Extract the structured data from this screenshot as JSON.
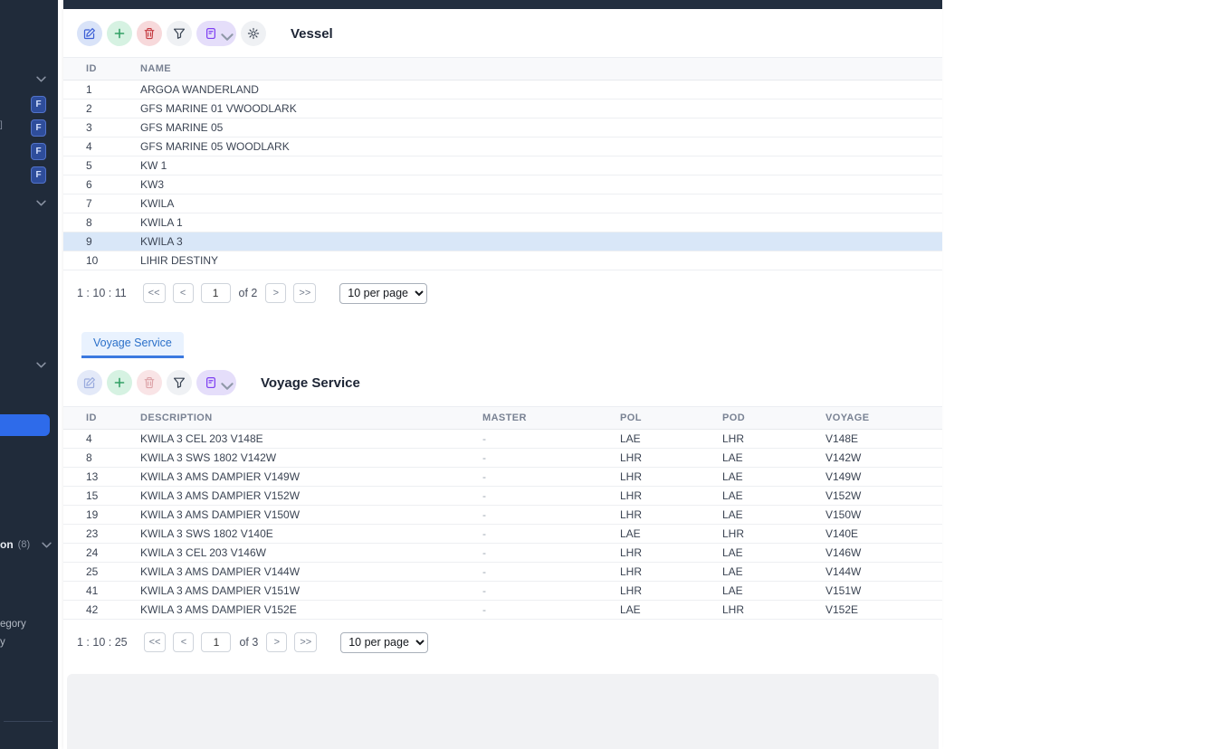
{
  "colors": {
    "sidebar_bg": "#202b3a",
    "accent_blue": "#2e6bea",
    "edit_blue": "#3c5fd6",
    "add_green": "#32a065",
    "delete_red": "#c4393f",
    "doc_purple": "#7e3ff2",
    "selected_row": "#d9e7f8",
    "tab_blue": "#2b70c9"
  },
  "sidebar": {
    "badges": [
      "F",
      "F",
      "F",
      "F"
    ],
    "truncated": {
      "bracket": "]",
      "item_label": "on",
      "item_count": "(8)",
      "text1": "egory",
      "text2": "y"
    }
  },
  "vessel_panel": {
    "title": "Vessel",
    "columns": [
      "ID",
      "NAME"
    ],
    "rows": [
      [
        "1",
        "ARGOA WANDERLAND"
      ],
      [
        "2",
        "GFS MARINE 01 VWOODLARK"
      ],
      [
        "3",
        "GFS MARINE 05"
      ],
      [
        "4",
        "GFS MARINE 05 WOODLARK"
      ],
      [
        "5",
        "KW 1"
      ],
      [
        "6",
        "KW3"
      ],
      [
        "7",
        "KWILA"
      ],
      [
        "8",
        "KWILA 1"
      ],
      [
        "9",
        "KWILA 3"
      ],
      [
        "10",
        "LIHIR DESTINY"
      ]
    ],
    "selected_index": 8,
    "pagination": {
      "range": "1 : 10 : 11",
      "first": "<<",
      "prev": "<",
      "page": "1",
      "of": "of 2",
      "next": ">",
      "last": ">>",
      "per_page": "10 per page"
    }
  },
  "tabs": {
    "voyage_service": "Voyage Service"
  },
  "voyage_panel": {
    "title": "Voyage Service",
    "columns": [
      "ID",
      "DESCRIPTION",
      "MASTER",
      "POL",
      "POD",
      "VOYAGE"
    ],
    "rows": [
      [
        "4",
        "KWILA 3 CEL 203 V148E",
        "-",
        "LAE",
        "LHR",
        "V148E"
      ],
      [
        "8",
        "KWILA 3 SWS 1802 V142W",
        "-",
        "LHR",
        "LAE",
        "V142W"
      ],
      [
        "13",
        "KWILA 3 AMS DAMPIER V149W",
        "-",
        "LHR",
        "LAE",
        "V149W"
      ],
      [
        "15",
        "KWILA 3 AMS DAMPIER V152W",
        "-",
        "LHR",
        "LAE",
        "V152W"
      ],
      [
        "19",
        "KWILA 3 AMS DAMPIER V150W",
        "-",
        "LHR",
        "LAE",
        "V150W"
      ],
      [
        "23",
        "KWILA 3 SWS 1802 V140E",
        "-",
        "LAE",
        "LHR",
        "V140E"
      ],
      [
        "24",
        "KWILA 3 CEL 203 V146W",
        "-",
        "LHR",
        "LAE",
        "V146W"
      ],
      [
        "25",
        "KWILA 3 AMS DAMPIER V144W",
        "-",
        "LHR",
        "LAE",
        "V144W"
      ],
      [
        "41",
        "KWILA 3 AMS DAMPIER V151W",
        "-",
        "LHR",
        "LAE",
        "V151W"
      ],
      [
        "42",
        "KWILA 3 AMS DAMPIER V152E",
        "-",
        "LAE",
        "LHR",
        "V152E"
      ]
    ],
    "pagination": {
      "range": "1 : 10 : 25",
      "first": "<<",
      "prev": "<",
      "page": "1",
      "of": "of 3",
      "next": ">",
      "last": ">>",
      "per_page": "10 per page"
    }
  }
}
